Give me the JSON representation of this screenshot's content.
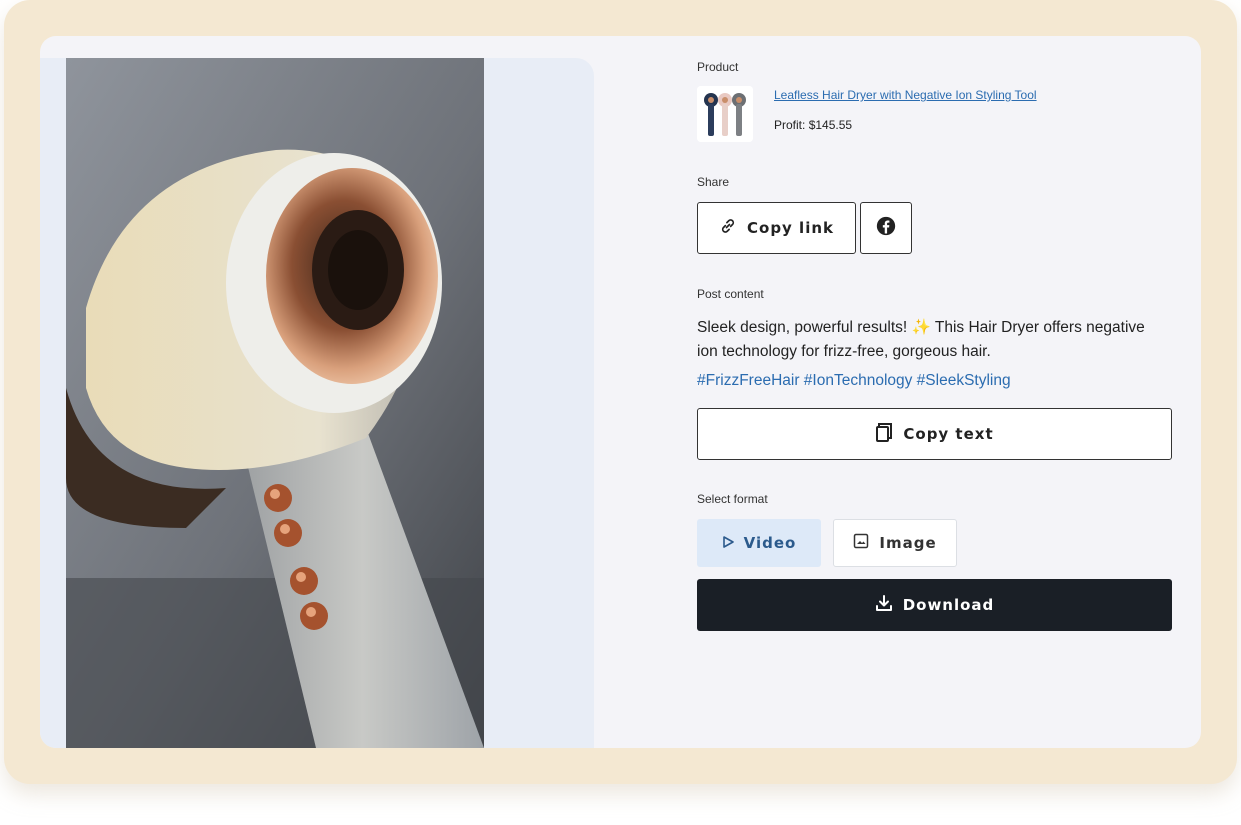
{
  "product": {
    "section_label": "Product",
    "name": "Leafless Hair Dryer with Negative Ion Styling Tool",
    "profit_label": "Profit:",
    "profit_value": "$145.55"
  },
  "share": {
    "section_label": "Share",
    "copy_link_label": "Copy link",
    "facebook_icon": "facebook-icon"
  },
  "post": {
    "section_label": "Post content",
    "text": "Sleek design, powerful results! ✨ This Hair Dryer offers negative ion technology for frizz-free, gorgeous hair.",
    "hashtags": "#FrizzFreeHair #IonTechnology #SleekStyling",
    "copy_text_label": "Copy text"
  },
  "format": {
    "section_label": "Select format",
    "options": [
      {
        "label": "Video",
        "icon": "play-icon",
        "selected": true
      },
      {
        "label": "Image",
        "icon": "image-icon",
        "selected": false
      }
    ]
  },
  "download_label": "Download",
  "colors": {
    "frame_bg": "#f4e8d2",
    "card_bg": "#f4f4f8",
    "link": "#2b6cb0",
    "primary_dark": "#1a1f26",
    "selected_bg": "#dde9f8"
  }
}
